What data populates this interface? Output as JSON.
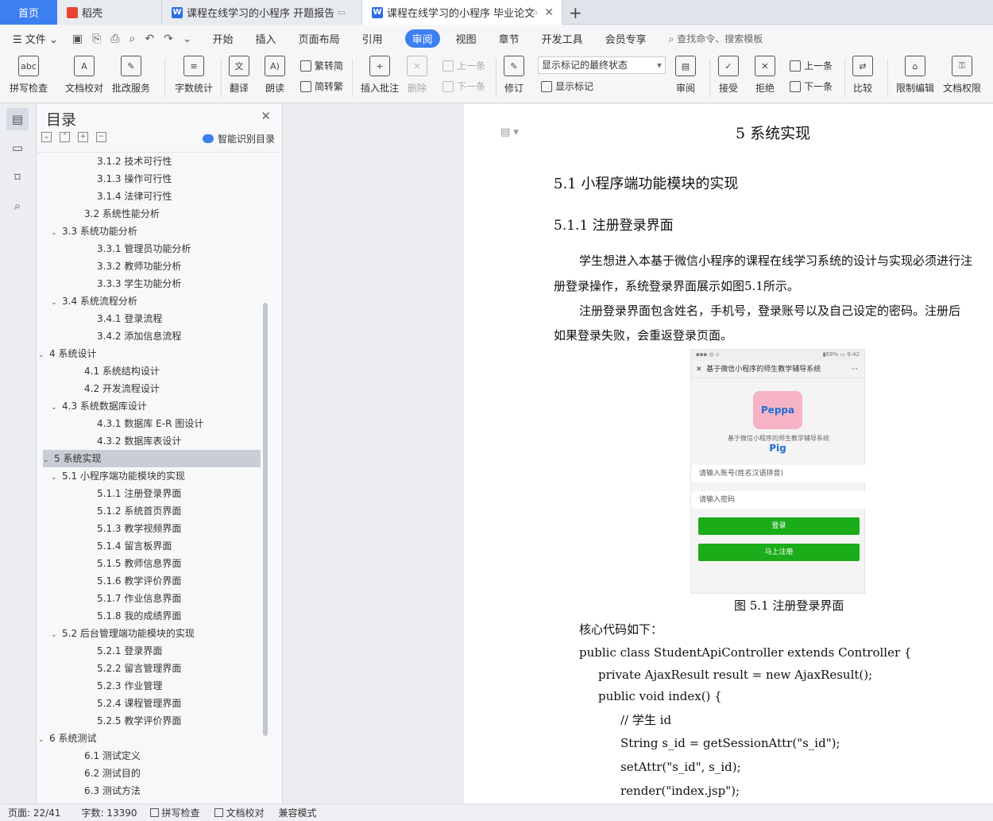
{
  "tabs": {
    "home": "首页",
    "daoke": "稻壳",
    "doc1": "课程在线学习的小程序 开题报告",
    "doc2": "课程在线学习的小程序 毕业论文",
    "add": "+"
  },
  "menu": {
    "file": "文件",
    "items": [
      "开始",
      "插入",
      "页面布局",
      "引用",
      "审阅",
      "视图",
      "章节",
      "开发工具",
      "会员专享"
    ],
    "search": "查找命令、搜索模板"
  },
  "ribbon": {
    "spell": "拼写检查",
    "proof": "文档校对",
    "annotate_service": "批改服务",
    "word_count": "字数统计",
    "translate": "翻译",
    "read": "朗读",
    "trad": "繁转简",
    "simp": "简转繁",
    "insert_comment": "插入批注",
    "delete": "删除",
    "prev": "上一条",
    "next": "下一条",
    "track": "修订",
    "markup_select": "显示标记的最终状态",
    "show_markup": "显示标记",
    "review": "审阅",
    "accept": "接受",
    "reject": "拒绝",
    "prev2": "上一条",
    "next2": "下一条",
    "compare": "比较",
    "restrict": "限制编辑",
    "permission": "文档权限",
    "abc": "abc"
  },
  "toc": {
    "title": "目录",
    "ai": "智能识别目录",
    "items": [
      {
        "t": "3.1.2 技术可行性",
        "lvl": 3
      },
      {
        "t": "3.1.3  操作可行性",
        "lvl": 3
      },
      {
        "t": "3.1.4 法律可行性",
        "lvl": 3
      },
      {
        "t": "3.2 系统性能分析",
        "lvl": 2
      },
      {
        "t": "3.3 系统功能分析",
        "lvl": 2,
        "c": 1
      },
      {
        "t": "3.3.1 管理员功能分析",
        "lvl": 3
      },
      {
        "t": "3.3.2 教师功能分析",
        "lvl": 3
      },
      {
        "t": "3.3.3 学生功能分析",
        "lvl": 3
      },
      {
        "t": "3.4 系统流程分析",
        "lvl": 2,
        "c": 1
      },
      {
        "t": "3.4.1 登录流程",
        "lvl": 3
      },
      {
        "t": "3.4.2 添加信息流程",
        "lvl": 3
      },
      {
        "t": "4  系统设计",
        "lvl": 1,
        "c": 1
      },
      {
        "t": "4.1 系统结构设计",
        "lvl": 2
      },
      {
        "t": "4.2 开发流程设计",
        "lvl": 2
      },
      {
        "t": "4.3 系统数据库设计",
        "lvl": 2,
        "c": 1
      },
      {
        "t": "4.3.1  数据库 E-R 图设计",
        "lvl": 3
      },
      {
        "t": "4.3.2  数据库表设计",
        "lvl": 3
      },
      {
        "t": "5  系统实现",
        "lvl": 1,
        "c": 1,
        "sel": 1
      },
      {
        "t": "5.1 小程序端功能模块的实现",
        "lvl": 2,
        "c": 1
      },
      {
        "t": "5.1.1 注册登录界面",
        "lvl": 3
      },
      {
        "t": "5.1.2 系统首页界面",
        "lvl": 3
      },
      {
        "t": "5.1.3 教学视频界面",
        "lvl": 3
      },
      {
        "t": "5.1.4 留言板界面",
        "lvl": 3
      },
      {
        "t": "5.1.5 教师信息界面",
        "lvl": 3
      },
      {
        "t": "5.1.6 教学评价界面",
        "lvl": 3
      },
      {
        "t": "5.1.7 作业信息界面",
        "lvl": 3
      },
      {
        "t": "5.1.8 我的成绩界面",
        "lvl": 3
      },
      {
        "t": "5.2 后台管理端功能模块的实现",
        "lvl": 2,
        "c": 1
      },
      {
        "t": "5.2.1 登录界面",
        "lvl": 3
      },
      {
        "t": "5.2.2 留言管理界面",
        "lvl": 3
      },
      {
        "t": "5.2.3 作业管理",
        "lvl": 3
      },
      {
        "t": "5.2.4 课程管理界面",
        "lvl": 3
      },
      {
        "t": "5.2.5 教学评价界面",
        "lvl": 3
      },
      {
        "t": "6  系统测试",
        "lvl": 1,
        "c": 1
      },
      {
        "t": "6.1  测试定义",
        "lvl": 2
      },
      {
        "t": "6.2  测试目的",
        "lvl": 2
      },
      {
        "t": "6.3  测试方法",
        "lvl": 2
      }
    ]
  },
  "doc": {
    "h1": "5  系统实现",
    "h2": "5.1 小程序端功能模块的实现",
    "h3": "5.1.1 注册登录界面",
    "p1a": "学生想进入本基于微信小程序的课程在线学习系统的设计与实现必须进行注",
    "p1b": "册登录操作，系统登录界面展示如图5.1所示。",
    "p2a": "注册登录界面包含姓名，手机号，登录账号以及自己设定的密码。注册后",
    "p2b": "如果登录失败，会重返登录页面。",
    "phone": {
      "status_left": "▪▪▪ ◎ ▫",
      "status_right": "▮69% ▭ 9:42",
      "nav_title": "基于微信小程序的师生教学辅导系统",
      "nav_close": "✕",
      "nav_more": "···",
      "logo": "Peppa Pig",
      "subtitle": "基于微信小程序的师生教学辅导系统",
      "account_placeholder": "请输入账号(姓名汉语拼音)",
      "password_placeholder": "请输入密码",
      "login": "登录",
      "register": "马上注册"
    },
    "caption": "图 5.1  注册登录界面",
    "core": "核心代码如下：",
    "code": [
      "public class  StudentApiController extends Controller {",
      "private AjaxResult result = new AjaxResult();",
      "public void index() {",
      "//  学生 id",
      "String  s_id = getSessionAttr(\"s_id\");",
      "setAttr(\"s_id\",    s_id);",
      "render(\"index.jsp\");"
    ]
  },
  "status": {
    "page": "页面: 22/41",
    "words": "字数: 13390",
    "spell": "拼写检查",
    "proof": "文档校对",
    "compat": "兼容模式"
  }
}
